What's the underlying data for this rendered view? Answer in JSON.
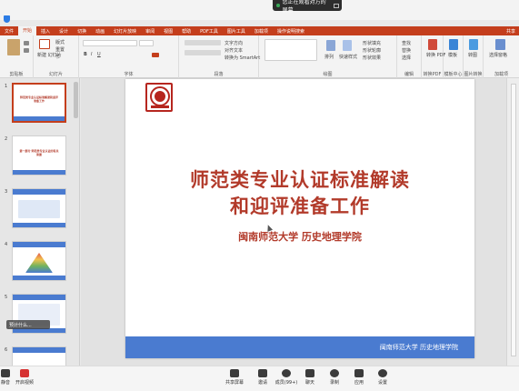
{
  "share_banner": {
    "text": "您正在观看对方的屏幕"
  },
  "ribbon_tabs": [
    "文件",
    "开始",
    "插入",
    "设计",
    "切换",
    "动画",
    "幻灯片放映",
    "审阅",
    "视图",
    "帮助",
    "PDF工具",
    "图片工具",
    "加载项",
    "操作说明搜索"
  ],
  "share_label": "共享",
  "ribbon_groups": {
    "clipboard": "剪贴板",
    "slides": "幻灯片",
    "font": "字体",
    "paragraph": "段落",
    "drawing": "绘图",
    "editing": "编辑",
    "pdf": "转换PDF",
    "template": "模板中心",
    "picture": "图片转换",
    "addin": "加载项"
  },
  "ribbon_buttons": {
    "new_slide": "新建\n幻灯片",
    "layout": "版式",
    "reset": "重置",
    "section": "节",
    "find": "查找",
    "replace": "替换",
    "select": "选择",
    "arrange": "排列",
    "quick_styles": "快速样式",
    "to_pdf": "转换\nPDF",
    "template": "模板",
    "picture": "转图",
    "selection_pane": "选择窗格",
    "text_direction": "文字方向",
    "align_text": "对齐文本",
    "smartart": "转换为 SmartArt",
    "shape_fill": "形状填充",
    "shape_outline": "形状轮廓",
    "shape_effect": "形状效果"
  },
  "thumbnails": [
    {
      "num": "1",
      "title": "师范类专业认证标准解读和迎评准备工作"
    },
    {
      "num": "2",
      "title": "第一部分 师范类专业认证的有关背景"
    },
    {
      "num": "3",
      "title": ""
    },
    {
      "num": "4",
      "title": ""
    },
    {
      "num": "5",
      "title": ""
    },
    {
      "num": "6",
      "title": ""
    }
  ],
  "slide": {
    "title_line1": "师范类专业认证标准解读",
    "title_line2": "和迎评准备工作",
    "subtitle": "闽南师范大学  历史地理学院",
    "footer": "闽南师范大学  历史地理学院"
  },
  "tooltip": "预计什么...",
  "meeting_bar": {
    "left_items": [
      "静音",
      "开启视频"
    ],
    "center_items": [
      "共享屏幕",
      "邀请",
      "成员(99+)",
      "聊天",
      "录制",
      "应用",
      "设置"
    ]
  },
  "colors": {
    "accent": "#c43e1c",
    "slide_title": "#b23a2a",
    "slide_footer": "#4a7bd0"
  }
}
